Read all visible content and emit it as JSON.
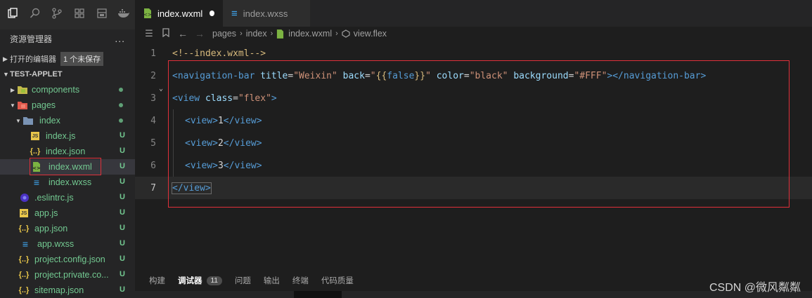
{
  "sidebar": {
    "explorer_title": "资源管理器",
    "more_label": "...",
    "open_editors": {
      "label": "打开的编辑器",
      "unsaved_badge": "1 个未保存"
    },
    "project": {
      "name": "TEST-APPLET"
    },
    "tree": [
      {
        "name": "components",
        "icon": "folder-icon",
        "status": "dot"
      },
      {
        "name": "pages",
        "icon": "folder-open-icon",
        "status": "dot"
      },
      {
        "name": "index",
        "icon": "folder-open-icon",
        "status": "dot"
      },
      {
        "name": "index.js",
        "icon": "js-file-icon",
        "status": "U"
      },
      {
        "name": "index.json",
        "icon": "json-file-icon",
        "status": "U"
      },
      {
        "name": "index.wxml",
        "icon": "wxml-file-icon",
        "status": "U"
      },
      {
        "name": "index.wxss",
        "icon": "wxss-file-icon",
        "status": "U"
      },
      {
        "name": ".eslintrc.js",
        "icon": "eslint-file-icon",
        "status": "U"
      },
      {
        "name": "app.js",
        "icon": "js-file-icon",
        "status": "U"
      },
      {
        "name": "app.json",
        "icon": "json-file-icon",
        "status": "U"
      },
      {
        "name": "app.wxss",
        "icon": "wxss-file-icon",
        "status": "U"
      },
      {
        "name": "project.config.json",
        "icon": "json-file-icon",
        "status": "U"
      },
      {
        "name": "project.private.co...",
        "icon": "json-file-icon",
        "status": "U"
      },
      {
        "name": "sitemap.json",
        "icon": "json-file-icon",
        "status": "U"
      }
    ]
  },
  "tabs": [
    {
      "label": "index.wxml",
      "dirty": true
    },
    {
      "label": "index.wxss",
      "dirty": false
    }
  ],
  "breadcrumb": [
    "pages",
    "index",
    "index.wxml",
    "view.flex"
  ],
  "code_lines": [
    {
      "num": "1"
    },
    {
      "num": "2"
    },
    {
      "num": "3"
    },
    {
      "num": "4"
    },
    {
      "num": "5"
    },
    {
      "num": "6"
    },
    {
      "num": "7"
    }
  ],
  "code": {
    "l1": "<!--index.wxml-->",
    "l2": {
      "open": "<navigation-bar",
      "a1": "title",
      "v1": "\"Weixin\"",
      "a2": "back",
      "v2q": "\"",
      "v2b1": "{{",
      "v2k": "false",
      "v2b2": "}}",
      "v2q2": "\"",
      "a3": "color",
      "v3": "\"black\"",
      "a4": "background",
      "v4": "\"#FFF\"",
      "close": "></navigation-bar>"
    },
    "l3": {
      "open": "<view",
      "attr": "class",
      "val": "\"flex\"",
      "close": ">"
    },
    "l4": {
      "open": "<view>",
      "text": "1",
      "close": "</view>"
    },
    "l5": {
      "open": "<view>",
      "text": "2",
      "close": "</view>"
    },
    "l6": {
      "open": "<view>",
      "text": "3",
      "close": "</view>"
    },
    "l7": "</view>"
  },
  "panel": {
    "tabs": [
      "构建",
      "调试器",
      "问题",
      "输出",
      "终端",
      "代码质量"
    ],
    "active_tab": "调试器",
    "debugger_count": "11"
  },
  "watermark": "CSDN @微风粼粼",
  "colors": {
    "highlight_border": "#e0303a",
    "git_untracked": "#73c991"
  }
}
